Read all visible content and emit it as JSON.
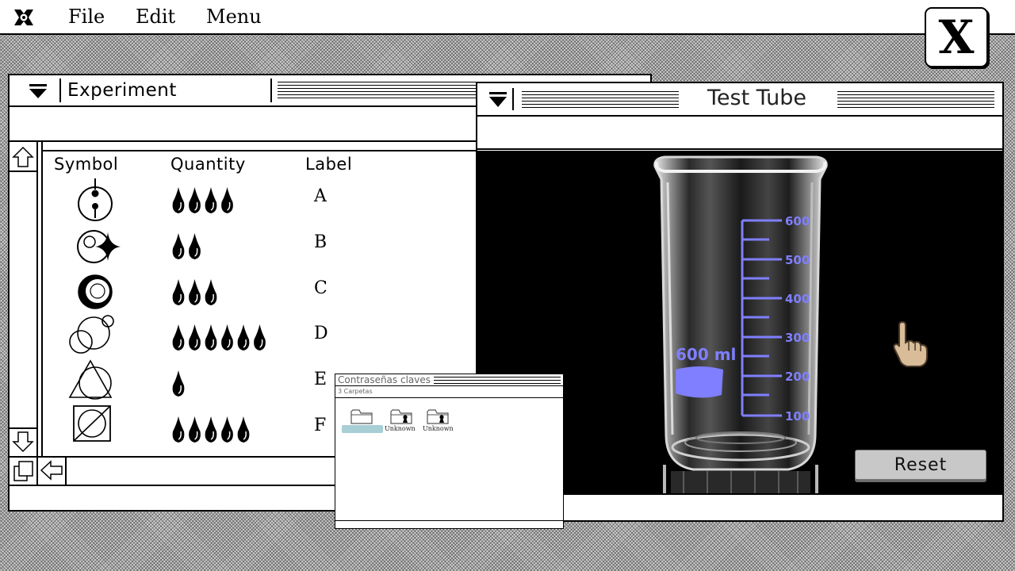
{
  "menubar": {
    "file": "File",
    "edit": "Edit",
    "menu": "Menu",
    "close": "X"
  },
  "experiment": {
    "title": "Experiment",
    "headers": {
      "symbol": "Symbol",
      "quantity": "Quantity",
      "label": "Label"
    },
    "rows": [
      {
        "symbol": "dot-circle-symbol",
        "drops": 4,
        "label": "A"
      },
      {
        "symbol": "sparkle-circle-symbol",
        "drops": 2,
        "label": "B"
      },
      {
        "symbol": "crescent-ring-symbol",
        "drops": 3,
        "label": "C"
      },
      {
        "symbol": "triple-circles-symbol",
        "drops": 6,
        "label": "D"
      },
      {
        "symbol": "triangle-circle-symbol",
        "drops": 1,
        "label": "E"
      },
      {
        "symbol": "crossed-square-symbol",
        "drops": 5,
        "label": "F"
      }
    ]
  },
  "test_tube": {
    "title": "Test Tube",
    "beaker_capacity": "600 ml",
    "scale_labels": [
      "600",
      "500",
      "400",
      "300",
      "200",
      "100"
    ],
    "reset_label": "Reset",
    "scale_color": "#7f7fff"
  },
  "passwords": {
    "title": "Contraseñas claves",
    "subtitle": "3 Carpetas",
    "folders": [
      {
        "label": "",
        "locked": false,
        "selected": true
      },
      {
        "label": "Unknown",
        "locked": true,
        "selected": false
      },
      {
        "label": "Unknown",
        "locked": true,
        "selected": false
      }
    ]
  },
  "icons": [
    "apple-logo-icon",
    "collapse-triangle-icon",
    "scroll-up-arrow-icon",
    "scroll-down-arrow-icon",
    "resize-icon",
    "scroll-left-arrow-icon",
    "pointing-hand-cursor-icon",
    "folder-icon",
    "locked-folder-icon"
  ]
}
